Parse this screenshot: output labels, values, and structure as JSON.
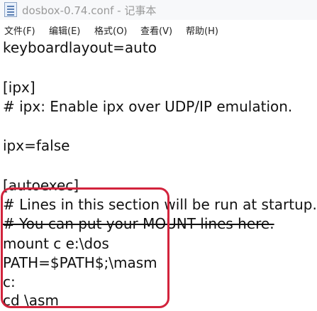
{
  "window": {
    "title": "dosbox-0.74.conf - 记事本",
    "icon": "notepad-icon"
  },
  "menubar": {
    "items": [
      {
        "label": "文件(F)"
      },
      {
        "label": "编辑(E)"
      },
      {
        "label": "格式(O)"
      },
      {
        "label": "查看(V)"
      },
      {
        "label": "帮助(H)"
      }
    ]
  },
  "editor": {
    "lines": [
      "keyboardlayout=auto",
      "",
      "[ipx]",
      "# ipx: Enable ipx over UDP/IP emulation.",
      "",
      "ipx=false",
      "",
      "[autoexec]",
      "# Lines in this section will be run at startup.",
      "# You can put your MOUNT lines here.",
      "mount c e:\\dos",
      "PATH=$PATH$;\\masm",
      "c:",
      "cd \\asm"
    ]
  },
  "annotation": {
    "color": "#d2233c"
  }
}
